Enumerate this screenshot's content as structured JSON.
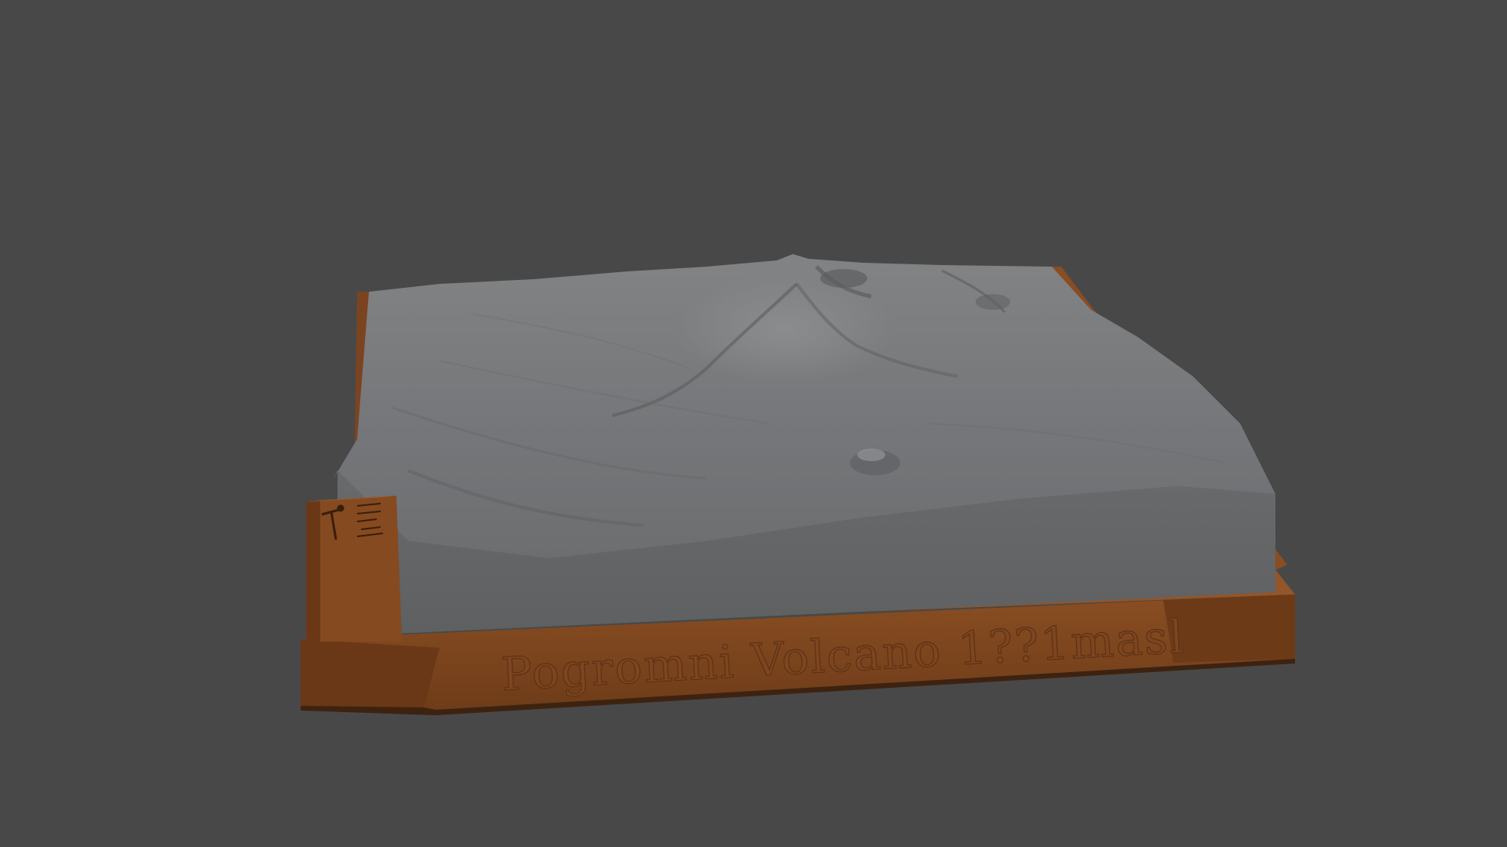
{
  "scene": {
    "background_color": "#484848",
    "terrain_color": "#737576",
    "terrain_side_color": "#636566",
    "base_color": "#7a4520",
    "base_dark_color": "#5c3216",
    "icons": [
      "hiker-icon",
      "compass-icon"
    ]
  },
  "plaque": {
    "title": "Pogromni Volcano 1??1masl"
  }
}
